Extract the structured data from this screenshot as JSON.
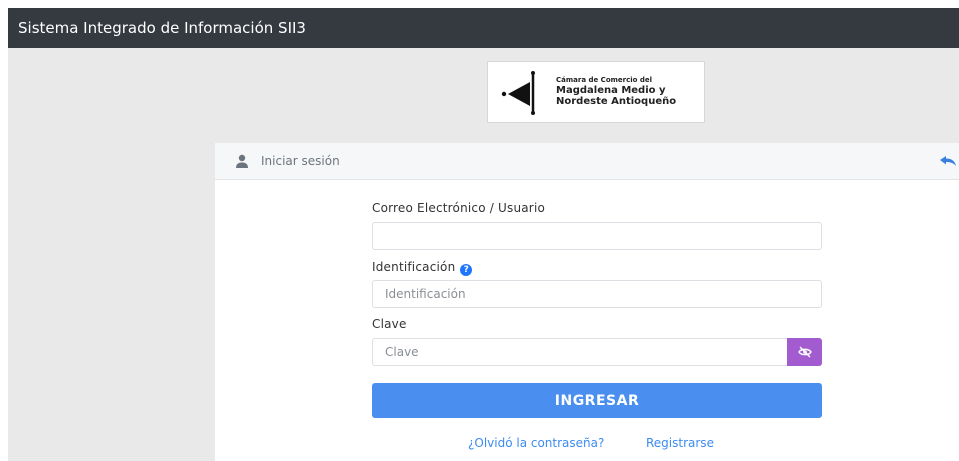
{
  "window": {
    "title": "Sistema Integrado de Información SII3"
  },
  "logo": {
    "line1": "Cámara de Comercio del",
    "line2": "Magdalena Medio y",
    "line3": "Nordeste Antioqueño"
  },
  "card": {
    "title": "Iniciar sesión",
    "user_icon": "user-icon",
    "back_icon": "back-arrow-icon"
  },
  "form": {
    "email": {
      "label": "Correo Electrónico / Usuario",
      "value": "",
      "placeholder": ""
    },
    "identification": {
      "label": "Identificación",
      "help_icon": "question-circle-icon",
      "value": "",
      "placeholder": "Identificación"
    },
    "password": {
      "label": "Clave",
      "value": "",
      "placeholder": "Clave",
      "toggle_icon": "eye-slash-icon"
    },
    "submit_label": "INGRESAR",
    "forgot_link": "¿Olvidó la contraseña?",
    "register_link": "Registrarse"
  },
  "colors": {
    "topbar": "#343a40",
    "primary": "#4a8ef0",
    "eye_button": "#a35bd0",
    "link": "#3c8cf0"
  }
}
